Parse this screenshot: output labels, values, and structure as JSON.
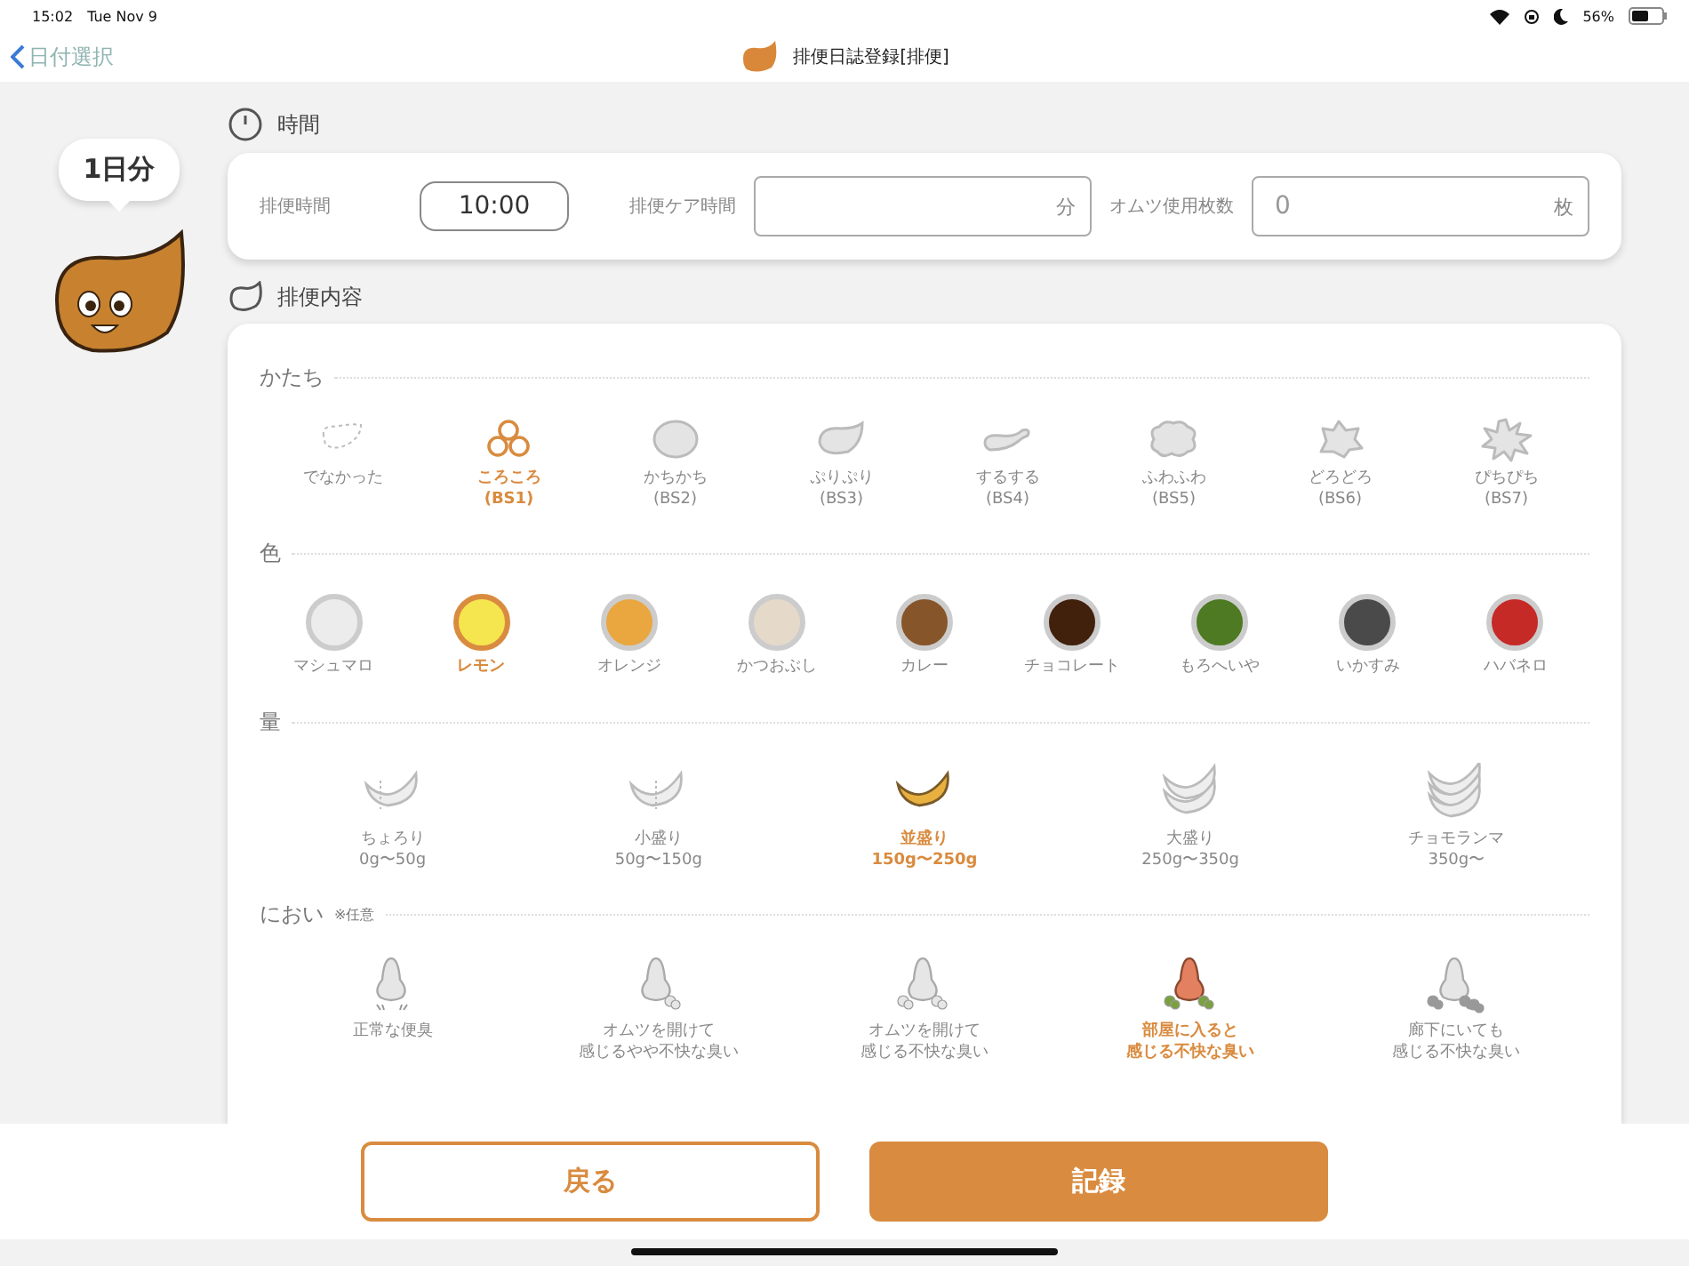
{
  "status_bar": {
    "time": "15:02",
    "date": "Tue Nov 9",
    "battery": "56%"
  },
  "nav": {
    "back": "日付選択",
    "title": "排便日誌登録[排便]"
  },
  "day_badge": "1日分",
  "time_section": {
    "title": "時間",
    "fields": [
      {
        "kind": "time",
        "label": "排便時間",
        "value": "10:00"
      },
      {
        "kind": "unit",
        "label": "排便ケア時間",
        "unit": "分"
      },
      {
        "kind": "unit",
        "label": "オムツ使用枚数",
        "placeholder": "0",
        "unit": "枚"
      }
    ]
  },
  "content_section": {
    "title": "排便内容",
    "shape": {
      "title": "かたち",
      "items": [
        {
          "kind": "none",
          "label": "でなかった",
          "selected": false
        },
        {
          "kind": "pellets",
          "label": "ころころ",
          "code": "(BS1)",
          "selected": true
        },
        {
          "kind": "lump",
          "label": "かちかち",
          "code": "(BS2)",
          "selected": false
        },
        {
          "kind": "blob",
          "label": "ぷりぷり",
          "code": "(BS3)",
          "selected": false
        },
        {
          "kind": "sausage",
          "label": "するする",
          "code": "(BS4)",
          "selected": false
        },
        {
          "kind": "fluffy",
          "label": "ふわふわ",
          "code": "(BS5)",
          "selected": false
        },
        {
          "kind": "mushy",
          "label": "どろどろ",
          "code": "(BS6)",
          "selected": false
        },
        {
          "kind": "watery",
          "label": "ぴちぴち",
          "code": "(BS7)",
          "selected": false
        }
      ]
    },
    "color": {
      "title": "色",
      "items": [
        {
          "label": "マシュマロ",
          "color": "#ececec",
          "selected": false
        },
        {
          "label": "レモン",
          "color": "#f5e54f",
          "selected": true
        },
        {
          "label": "オレンジ",
          "color": "#eaa63f",
          "selected": false
        },
        {
          "label": "かつおぶし",
          "color": "#e5d9ca",
          "selected": false
        },
        {
          "label": "カレー",
          "color": "#87552a",
          "selected": false
        },
        {
          "label": "チョコレート",
          "color": "#41200c",
          "selected": false
        },
        {
          "label": "もろへいや",
          "color": "#4d7a22",
          "selected": false
        },
        {
          "label": "いかすみ",
          "color": "#4a4a4a",
          "selected": false
        },
        {
          "label": "ハバネロ",
          "color": "#c52a27",
          "selected": false
        }
      ]
    },
    "amount": {
      "title": "量",
      "items": [
        {
          "kind": "sliver",
          "label": "ちょろり",
          "range": "0g〜50g",
          "selected": false
        },
        {
          "kind": "half",
          "label": "小盛り",
          "range": "50g〜150g",
          "selected": false
        },
        {
          "kind": "one",
          "label": "並盛り",
          "range": "150g〜250g",
          "selected": true
        },
        {
          "kind": "two",
          "label": "大盛り",
          "range": "250g〜350g",
          "selected": false
        },
        {
          "kind": "three",
          "label": "チョモランマ",
          "range": "350g〜",
          "selected": false
        }
      ]
    },
    "odor": {
      "title": "におい",
      "note": "※任意",
      "items": [
        {
          "kind": "normal",
          "lines": [
            "正常な便臭"
          ],
          "selected": false
        },
        {
          "kind": "light",
          "lines": [
            "オムツを開けて",
            "感じるやや不快な臭い"
          ],
          "selected": false
        },
        {
          "kind": "medium",
          "lines": [
            "オムツを開けて",
            "感じる不快な臭い"
          ],
          "selected": false
        },
        {
          "kind": "strong",
          "lines": [
            "部屋に入ると",
            "感じる不快な臭い"
          ],
          "selected": true
        },
        {
          "kind": "hall",
          "lines": [
            "廊下にいても",
            "感じる不快な臭い"
          ],
          "selected": false
        }
      ]
    }
  },
  "buttons": {
    "back": "戻る",
    "record": "記録"
  }
}
